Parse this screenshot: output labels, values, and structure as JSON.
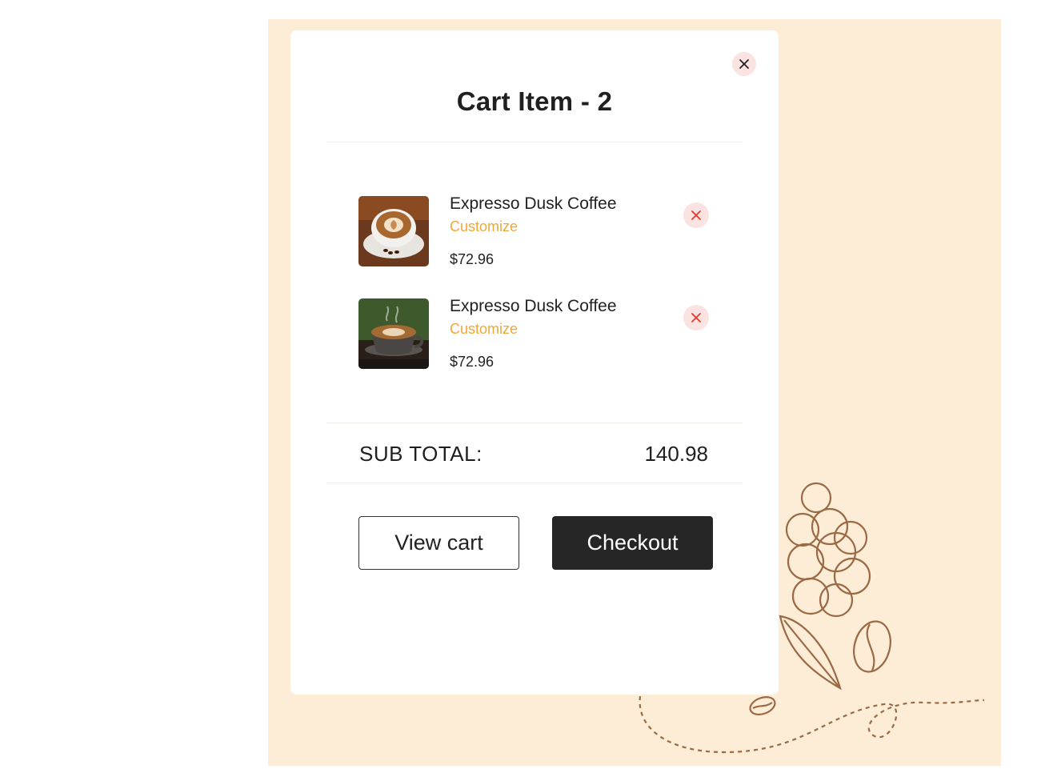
{
  "cart": {
    "title": "Cart Item - 2",
    "items": [
      {
        "name": "Expresso Dusk Coffee",
        "customize_label": "Customize",
        "price": "$72.96",
        "image_icon": "latte-cup-photo"
      },
      {
        "name": "Expresso Dusk Coffee",
        "customize_label": "Customize",
        "price": "$72.96",
        "image_icon": "coffee-cup-photo"
      }
    ],
    "subtotal_label": "SUB TOTAL:",
    "subtotal_value": "140.98",
    "view_cart_label": "View cart",
    "checkout_label": "Checkout"
  },
  "icons": {
    "close": "close-icon",
    "remove": "remove-icon"
  },
  "colors": {
    "backdrop": "#fdecd6",
    "accent": "#f0a73a",
    "remove": "#e03a2f",
    "checkout": "#262626",
    "sketch": "#9b6a44"
  }
}
